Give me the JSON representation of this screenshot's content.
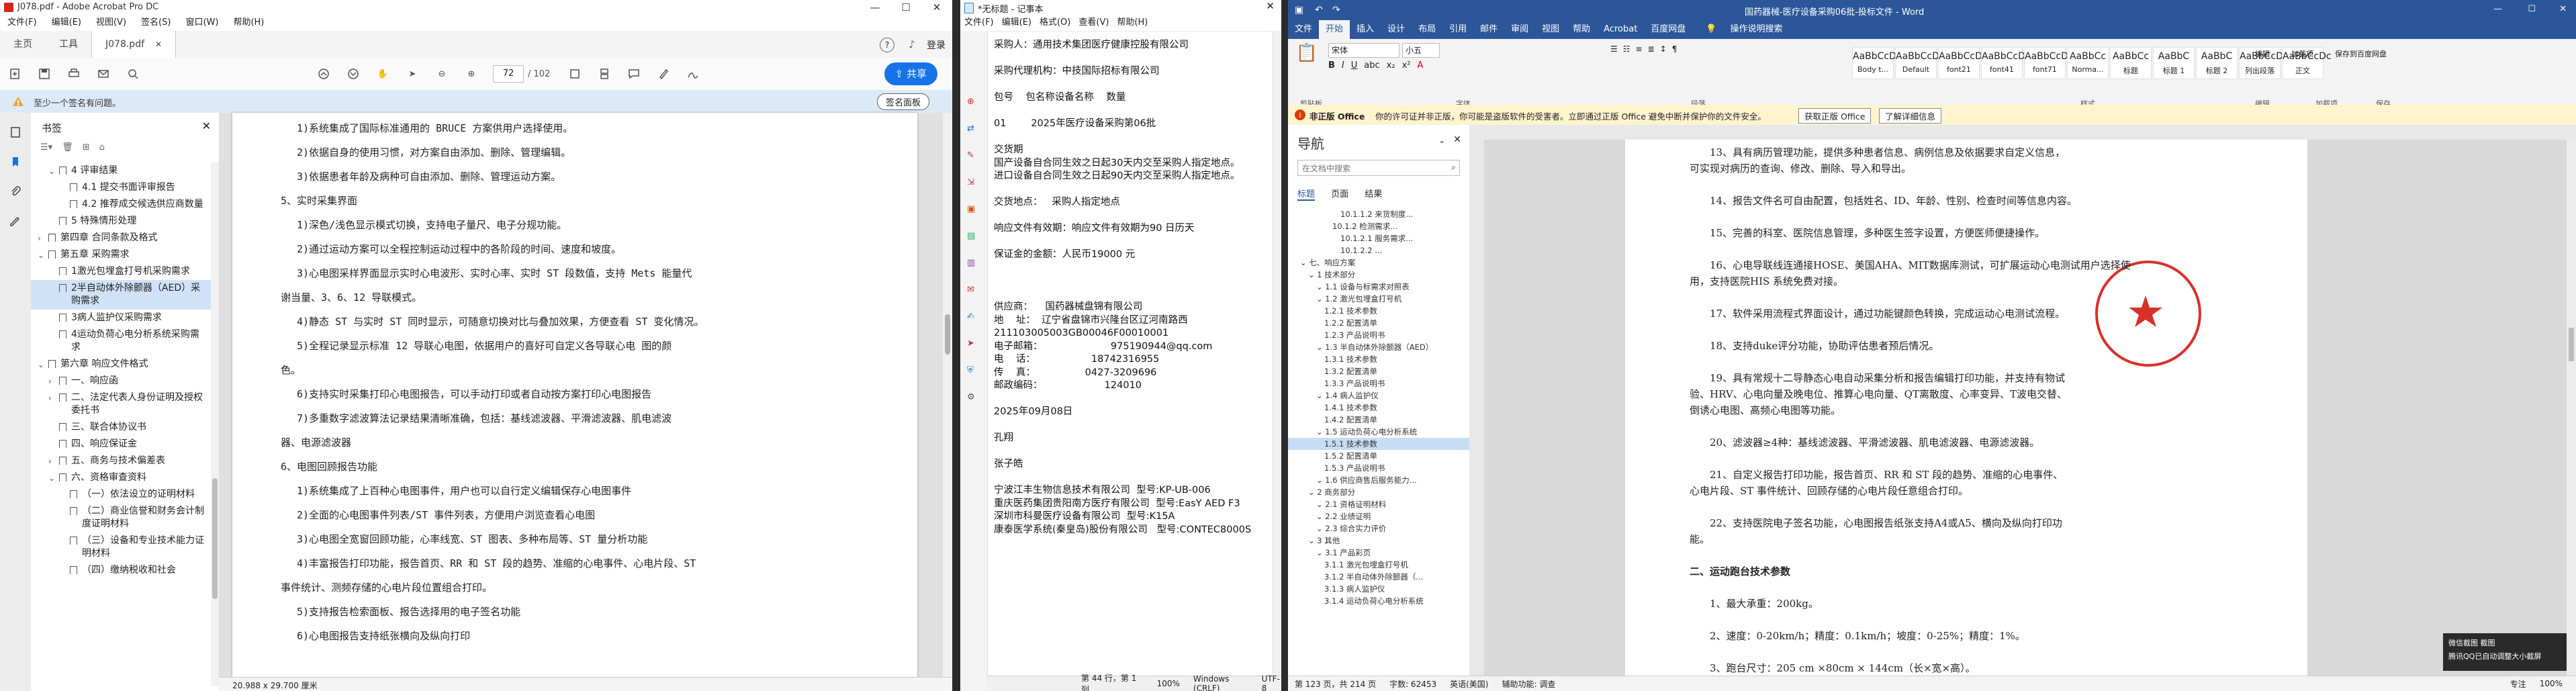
{
  "acrobat": {
    "title": "J078.pdf - Adobe Acrobat Pro DC",
    "menu": [
      "文件(F)",
      "编辑(E)",
      "视图(V)",
      "签名(S)",
      "窗口(W)",
      "帮助(H)"
    ],
    "tabs": {
      "home": "主页",
      "tools": "工具",
      "file": "J078.pdf"
    },
    "login": "登录",
    "page_current": "72",
    "page_total": "/ 102",
    "zoom": "101%",
    "share": "共享",
    "notice": "至少一个签名有问题。",
    "sign_panel": "签名面板",
    "bookmarks_title": "书签",
    "bookmarks": [
      {
        "label": "4 评审结果",
        "level": 1,
        "caret": "v"
      },
      {
        "label": "4.1 提交书面评审报告",
        "level": 2,
        "caret": ""
      },
      {
        "label": "4.2 推荐成交候选供应商数量",
        "level": 2,
        "caret": ""
      },
      {
        "label": "5 特殊情形处理",
        "level": 1,
        "caret": ""
      },
      {
        "label": "第四章 合同条款及格式",
        "level": 0,
        "caret": ">"
      },
      {
        "label": "第五章 采购需求",
        "level": 0,
        "caret": "v"
      },
      {
        "label": "1激光包埋盒打号机采购需求",
        "level": 1,
        "caret": ""
      },
      {
        "label": "2半自动体外除颤器（AED）采购需求",
        "level": 1,
        "caret": "",
        "selected": true
      },
      {
        "label": "3病人监护仪采购需求",
        "level": 1,
        "caret": ""
      },
      {
        "label": "4运动负荷心电分析系统采购需求",
        "level": 1,
        "caret": ""
      },
      {
        "label": "第六章 响应文件格式",
        "level": 0,
        "caret": "v"
      },
      {
        "label": "一、响应函",
        "level": 1,
        "caret": ">"
      },
      {
        "label": "二、法定代表人身份证明及授权委托书",
        "level": 1,
        "caret": ">"
      },
      {
        "label": "三、联合体协议书",
        "level": 1,
        "caret": ""
      },
      {
        "label": "四、响应保证金",
        "level": 1,
        "caret": ""
      },
      {
        "label": "五、商务与技术偏差表",
        "level": 1,
        "caret": ">"
      },
      {
        "label": "六、资格审查资料",
        "level": 1,
        "caret": "v"
      },
      {
        "label": "（一）依法设立的证明材料",
        "level": 2,
        "caret": ""
      },
      {
        "label": "（二）商业信誉和财务会计制度证明材料",
        "level": 2,
        "caret": ""
      },
      {
        "label": "（三）设备和专业技术能力证明材料",
        "level": 2,
        "caret": ""
      },
      {
        "label": "（四）缴纳税收和社会",
        "level": 2,
        "caret": ""
      }
    ],
    "pdf_lines": [
      "1)系统集成了国际标准通用的 BRUCE 方案供用户选择使用。",
      "2)依据自身的使用习惯，对方案自由添加、删除、管理编辑。",
      "3)依据患者年龄及病种可自由添加、删除、管理运动方案。",
      "5、实时采集界面",
      "1)深色/浅色显示模式切换，支持电子量尺、电子分规功能。",
      "2)通过运动方案可以全程控制运动过程中的各阶段的时间、速度和坡度。",
      "3)心电图采样界面显示实时心电波形、实时心率、实时 ST 段数值，支持 Mets 能量代",
      "谢当量、3、6、12 导联模式。",
      "4)静态 ST 与实时 ST 同时显示，可随意切换对比与叠加效果，方便查看 ST 变化情况。",
      "5)全程记录显示标准 12 导联心电图，依据用户的喜好可自定义各导联心电 图的颜",
      "色。",
      "6)支持实时采集打印心电图报告，可以手动打印或者自动按方案打印心电图报告",
      "7)多重数字滤波算法记录结果清晰准确，包括：基线滤波器、平滑滤波器、肌电滤波",
      "器、电源滤波器",
      "6、电图回顾报告功能",
      "1)系统集成了上百种心电图事件，用户也可以自行定义编辑保存心电图事件",
      "2)全面的心电图事件列表/ST 事件列表，方便用户浏览查看心电图",
      "3)心电图全宽窗回顾功能，心率线宽、ST 图表、多种布局等、ST 量分析功能",
      "4)丰富报告打印功能，报告首页、RR 和 ST 段的趋势、准缩的心电事件、心电片段、ST",
      "事件统计、测频存储的心电片段位置组合打印。",
      "5)支持报告检索面板、报告选择用的电子签名功能",
      "6)心电图报告支持纸张横向及纵向打印"
    ],
    "page_size": "20.988 x 29.700 厘米"
  },
  "notepad": {
    "title": "*无标题 - 记事本",
    "menu": [
      "文件(F)",
      "编辑(E)",
      "格式(O)",
      "查看(V)",
      "帮助(H)"
    ],
    "lines": [
      "采购人：通用技术集团医疗健康控股有限公司",
      "",
      "采购代理机构：中技国际招标有限公司",
      "",
      "包号    包名称设备名称    数量",
      "",
      "01        2025年医疗设备采购第06批",
      "",
      "交货期",
      "国产设备自合同生效之日起30天内交至采购人指定地点。",
      "进口设备自合同生效之日起90天内交至采购人指定地点。",
      "",
      "交货地点：   采购人指定地点",
      "",
      "响应文件有效期：响应文件有效期为90 日历天",
      "",
      "保证金的金额：人民币19000 元",
      "",
      "",
      "",
      "供应商：    国药器械盘锦有限公司",
      "地    址：  辽宁省盘锦市兴隆台区辽河南路西",
      "211103005003GB00046F00010001",
      "电子邮箱：                      975190944@qq.com",
      "电    话：                  18742316955",
      "传    真：                0427-3209696",
      "邮政编码：                    124010",
      "",
      "2025年09月08日",
      "",
      "孔翔",
      "",
      "张子皓",
      "",
      "宁波江丰生物信息技术有限公司  型号:KP-UB-006",
      "重庆医药集团贵阳南方医疗有限公司  型号:EasY AED F3",
      "深圳市科曼医疗设备有限公司  型号:K15A",
      "康泰医学系统(秦皇岛)股份有限公司   型号:CONTEC8000S"
    ],
    "status": [
      "第 44 行，第 1 列",
      "100%",
      "Windows (CRLF)",
      "UTF-8"
    ]
  },
  "word": {
    "title": "国药器械-医疗设备采购06批-投标文件 - Word",
    "tabs": [
      "文件",
      "开始",
      "插入",
      "设计",
      "布局",
      "引用",
      "邮件",
      "审阅",
      "视图",
      "帮助",
      "Acrobat",
      "百度网盘",
      "操作说明搜索"
    ],
    "active_tab": "开始",
    "font_name": "宋体",
    "font_size": "小五",
    "styles": [
      {
        "preview": "AaBbCcDc",
        "name": "Body t..."
      },
      {
        "preview": "AaBbCcDc",
        "name": "Default"
      },
      {
        "preview": "AaBbCcDc",
        "name": "font21"
      },
      {
        "preview": "AaBbCcDc",
        "name": "font41"
      },
      {
        "preview": "AaBbCcDc",
        "name": "font71"
      },
      {
        "preview": "AaBbCc",
        "name": "Norma..."
      },
      {
        "preview": "AaBbCc",
        "name": "标题"
      },
      {
        "preview": "AaBbC",
        "name": "标题 1"
      },
      {
        "preview": "AaBbC",
        "name": "标题 2"
      },
      {
        "preview": "AaBbCcDc",
        "name": "列出段落"
      },
      {
        "preview": "AaBbCcDc",
        "name": "正文"
      }
    ],
    "ribbon_groups": [
      "剪贴板",
      "字体",
      "段落",
      "样式",
      "编辑",
      "加载项",
      "保存"
    ],
    "ribbon_right": [
      "编辑",
      "加载项",
      "保存到百度网盘"
    ],
    "notice_label": "非正版 Office",
    "notice_text": "你的许可证并非正版，你可能是盗版软件的受害者。立即通过正版 Office 避免中断并保护你的文件安全。",
    "notice_btn1": "获取正版 Office",
    "notice_btn2": "了解详细信息",
    "nav_title": "导航",
    "nav_search": "在文档中搜索",
    "nav_tabs": [
      "标题",
      "页面",
      "结果"
    ],
    "nav_items": [
      {
        "label": "10.1.1.2 来货制度...",
        "level": 5
      },
      {
        "label": "10.1.2 检测需求...",
        "level": 4
      },
      {
        "label": "10.1.2.1 服务需求...",
        "level": 5
      },
      {
        "label": "10.1.2.2 ...",
        "level": 5
      },
      {
        "label": "七、响应方案",
        "level": 0
      },
      {
        "label": "1 技术部分",
        "level": 1
      },
      {
        "label": "1.1 设备与标需求对照表",
        "level": 2
      },
      {
        "label": "1.2 激光包埋盒打号机",
        "level": 2
      },
      {
        "label": "1.2.1 技术参数",
        "level": 3
      },
      {
        "label": "1.2.2 配置清单",
        "level": 3
      },
      {
        "label": "1.2.3 产品说明书",
        "level": 3
      },
      {
        "label": "1.3 半自动体外除颤器（AED）",
        "level": 2
      },
      {
        "label": "1.3.1 技术参数",
        "level": 3
      },
      {
        "label": "1.3.2 配置清单",
        "level": 3
      },
      {
        "label": "1.3.3 产品说明书",
        "level": 3
      },
      {
        "label": "1.4 病人监护仪",
        "level": 2
      },
      {
        "label": "1.4.1 技术参数",
        "level": 3
      },
      {
        "label": "1.4.2 配置清单",
        "level": 3
      },
      {
        "label": "1.5 运动负荷心电分析系统",
        "level": 2
      },
      {
        "label": "1.5.1 技术参数",
        "level": 3,
        "selected": true
      },
      {
        "label": "1.5.2 配置清单",
        "level": 3
      },
      {
        "label": "1.5.3 产品说明书",
        "level": 3
      },
      {
        "label": "1.6 供应商售后服务能力...",
        "level": 2
      },
      {
        "label": "2 商务部分",
        "level": 1
      },
      {
        "label": "2.1 资格证明材料",
        "level": 2
      },
      {
        "label": "2.2 业绩证明",
        "level": 2
      },
      {
        "label": "2.3 综合实力评价",
        "level": 2
      },
      {
        "label": "3 其他",
        "level": 1
      },
      {
        "label": "3.1 产品彩页",
        "level": 2
      },
      {
        "label": "3.1.1 激光包埋盒打号机",
        "level": 3
      },
      {
        "label": "3.1.2 半自动体外除颤器（...",
        "level": 3
      },
      {
        "label": "3.1.3 病人监护仪",
        "level": 3
      },
      {
        "label": "3.1.4 运动负荷心电分析系统",
        "level": 3
      }
    ],
    "doc_paras": [
      {
        "text": "13、具有病历管理功能，提供多种患者信息、病例信息及依据要求自定义信息，",
        "indent": 1
      },
      {
        "text": "可实现对病历的查询、修改、删除、导入和导出。",
        "indent": 0
      },
      {
        "text": "",
        "indent": 0
      },
      {
        "text": "14、报告文件名可自由配置，包括姓名、ID、年龄、性别、检查时间等信息内容。",
        "indent": 1
      },
      {
        "text": "",
        "indent": 0
      },
      {
        "text": "15、完善的科室、医院信息管理，多种医生签字设置，方便医师便捷操作。",
        "indent": 1
      },
      {
        "text": "",
        "indent": 0
      },
      {
        "text": "16、心电导联线连通接HOSE、美国AHA、MIT数据库测试，可扩展运动心电测试用户选择使",
        "indent": 1
      },
      {
        "text": "用，支持医院HIS 系统免费对接。",
        "indent": 0
      },
      {
        "text": "",
        "indent": 0
      },
      {
        "text": "17、软件采用流程式界面设计，通过功能键颜色转换，完成运动心电测试流程。",
        "indent": 1
      },
      {
        "text": "",
        "indent": 0
      },
      {
        "text": "18、支持duke评分功能，协助评估患者预后情况。",
        "indent": 1
      },
      {
        "text": "",
        "indent": 0
      },
      {
        "text": "19、具有常规十二导静态心电自动采集分析和报告编辑打印功能，并支持有物试",
        "indent": 1
      },
      {
        "text": "验、HRV、心电向量及晚电位、推算心电向量、QT离散度、心率变异、T波电交替、",
        "indent": 0
      },
      {
        "text": "倒诱心电图、高频心电图等功能。",
        "indent": 0
      },
      {
        "text": "",
        "indent": 0
      },
      {
        "text": "20、滤波器≥4种：基线滤波器、平滑滤波器、肌电滤波器、电源滤波器。",
        "indent": 1
      },
      {
        "text": "",
        "indent": 0
      },
      {
        "text": "21、自定义报告打印功能，报告首页、RR 和 ST 段的趋势、准缩的心电事件、",
        "indent": 1
      },
      {
        "text": "心电片段、ST 事件统计、回顾存储的心电片段任意组合打印。",
        "indent": 0
      },
      {
        "text": "",
        "indent": 0
      },
      {
        "text": "22、支持医院电子签名功能，心电图报告纸张支持A4或A5、横向及纵向打印功",
        "indent": 1
      },
      {
        "text": "能。",
        "indent": 0
      },
      {
        "text": "",
        "indent": 0
      },
      {
        "text": "二、运动跑台技术参数",
        "indent": 0,
        "bold": true
      },
      {
        "text": "",
        "indent": 0
      },
      {
        "text": "1、最大承重：200kg。",
        "indent": 1
      },
      {
        "text": "",
        "indent": 0
      },
      {
        "text": "2、速度：0-20km/h；精度：0.1km/h；坡度：0-25%；精度：1%。",
        "indent": 1
      },
      {
        "text": "",
        "indent": 0
      },
      {
        "text": "3、跑台尺寸：205 cm ×80cm × 144cm（长×宽×高）。",
        "indent": 1
      }
    ],
    "toast_title": "微信截图 截图",
    "toast_text": "腾讯QQ已自动调整大小截屏",
    "status_left": [
      "第 123 页，共 214 页",
      "字数: 62453",
      "英语(美国)",
      "辅助功能: 调查"
    ],
    "status_right": [
      "专注",
      "100%"
    ],
    "accent": "#2b579a"
  }
}
